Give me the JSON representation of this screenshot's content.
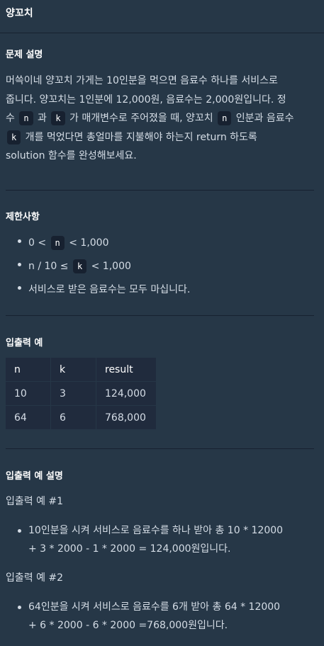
{
  "title": "양꼬치",
  "sections": {
    "description_heading": "문제 설명",
    "description_line1": "머쓱이네 양꼬치 가게는 10인분을 먹으면 음료수 하나를 서비스로",
    "description_line2": "줍니다. 양꼬치는 1인분에 12,000원, 음료수는 2,000원입니다. 정",
    "description_line3_a": "수 ",
    "description_line3_code1": "n",
    "description_line3_b": " 과 ",
    "description_line3_code2": "k",
    "description_line3_c": " 가 매개변수로 주어졌을 때, 양꼬치 ",
    "description_line3_code3": "n",
    "description_line3_d": " 인분과 음료수",
    "description_line4_code": "k",
    "description_line4_a": " 개를 먹었다면 총얼마를 지불해야 하는지 return 하도록",
    "description_line5": "solution 함수를 완성해보세요.",
    "constraints_heading": "제한사항",
    "constraint1_a": "0 < ",
    "constraint1_code": "n",
    "constraint1_b": " < 1,000",
    "constraint2_a": "n / 10 ≤ ",
    "constraint2_code": "k",
    "constraint2_b": " < 1,000",
    "constraint3": "서비스로 받은 음료수는 모두 마십니다.",
    "examples_heading": "입출력 예",
    "table_headers": [
      "n",
      "k",
      "result"
    ],
    "table_rows": [
      [
        "10",
        "3",
        "124,000"
      ],
      [
        "64",
        "6",
        "768,000"
      ]
    ],
    "explanation_heading": "입출력 예 설명",
    "example1_label": "입출력 예 #1",
    "example1_line1": "10인분을 시켜 서비스로 음료수를 하나 받아 총 10 * 12000",
    "example1_line2": "+ 3 * 2000 - 1 * 2000 = 124,000원입니다.",
    "example2_label": "입출력 예 #2",
    "example2_line1": "64인분을 시켜 서비스로 음료수를 6개 받아 총 64 * 12000",
    "example2_line2": "+ 6 * 2000 - 6 * 2000 =768,000원입니다."
  }
}
